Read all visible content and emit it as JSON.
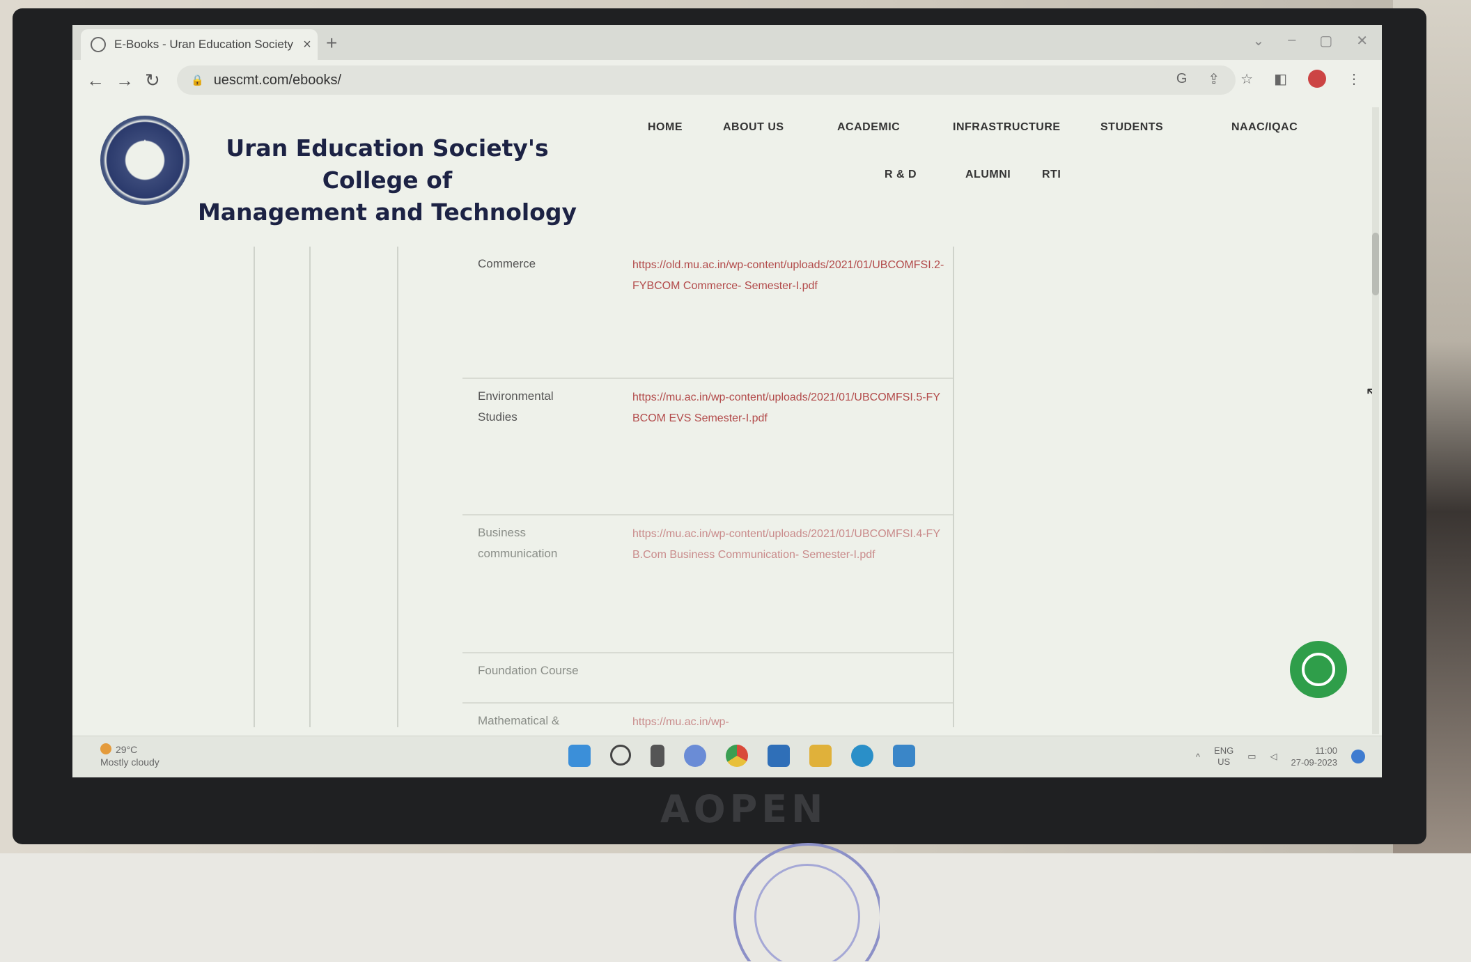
{
  "browser": {
    "tab_title": "E-Books - Uran Education Society",
    "tab_close": "×",
    "new_tab": "+",
    "url": "uescmt.com/ebooks/"
  },
  "site": {
    "college_name_line1": "Uran Education Society's College of",
    "college_name_line2": "Management and Technology",
    "nav": [
      {
        "label": "HOME"
      },
      {
        "label": "ABOUT US"
      },
      {
        "label": "ACADEMIC"
      },
      {
        "label": "INFRASTRUCTURE"
      },
      {
        "label": "STUDENTS"
      },
      {
        "label": "NAAC/IQAC"
      },
      {
        "label": "R & D"
      },
      {
        "label": "ALUMNI"
      },
      {
        "label": "RTI"
      }
    ]
  },
  "ebooks": [
    {
      "subject": "Commerce",
      "link": "https://old.mu.ac.in/wp-content/uploads/2021/01/UBCOMFSI.2-FYBCOM Commerce- Semester-I.pdf"
    },
    {
      "subject": "Environmental Studies",
      "link": "https://mu.ac.in/wp-content/uploads/2021/01/UBCOMFSI.5-FYBCOM EVS Semester-I.pdf"
    },
    {
      "subject": "Business communication",
      "link": "https://mu.ac.in/wp-content/uploads/2021/01/UBCOMFSI.4-FYB.Com Business Communication- Semester-I.pdf"
    },
    {
      "subject": "Foundation Course",
      "link": ""
    },
    {
      "subject": "Mathematical &",
      "link": "https://mu.ac.in/wp-"
    }
  ],
  "taskbar": {
    "temperature": "29°C",
    "weather": "Mostly cloudy",
    "lang_top": "ENG",
    "lang_bottom": "US",
    "time": "11:00",
    "date": "27-09-2023"
  },
  "monitor_brand": "AOPEN"
}
